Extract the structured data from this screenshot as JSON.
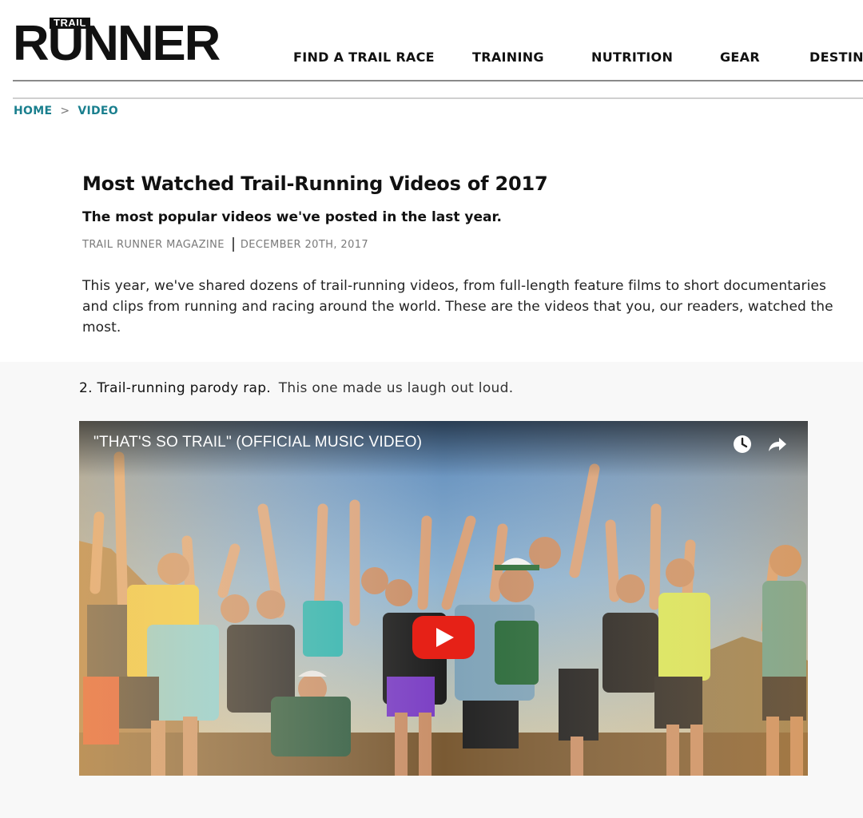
{
  "logo": {
    "small": "TRAIL",
    "big": "RUNNER"
  },
  "nav": {
    "items": [
      "FIND A TRAIL RACE",
      "TRAINING",
      "NUTRITION",
      "GEAR",
      "DESTINA"
    ]
  },
  "breadcrumb": {
    "home": "HOME",
    "sep": ">",
    "current": "VIDEO"
  },
  "article": {
    "title": "Most Watched Trail-Running Videos of 2017",
    "subtitle": "The most popular videos we've posted in the last year.",
    "author": "TRAIL RUNNER MAGAZINE",
    "date": "DECEMBER 20TH, 2017",
    "intro": "This year,  we've shared dozens of trail-running videos, from full-length feature films to short documentaries and clips from running and racing around the world. These are the videos that you, our readers, watched the most."
  },
  "item": {
    "number": "2.",
    "heading": "Trail-running parody rap.",
    "description": "This one made us laugh out loud."
  },
  "video": {
    "title": "\"THAT'S SO TRAIL\" (OFFICIAL MUSIC VIDEO)",
    "icons": [
      "clock-icon",
      "share-icon",
      "play-icon"
    ],
    "play_color": "#e62117"
  },
  "colors": {
    "accent": "#1a7f8e",
    "rule": "#8a8a8a"
  }
}
